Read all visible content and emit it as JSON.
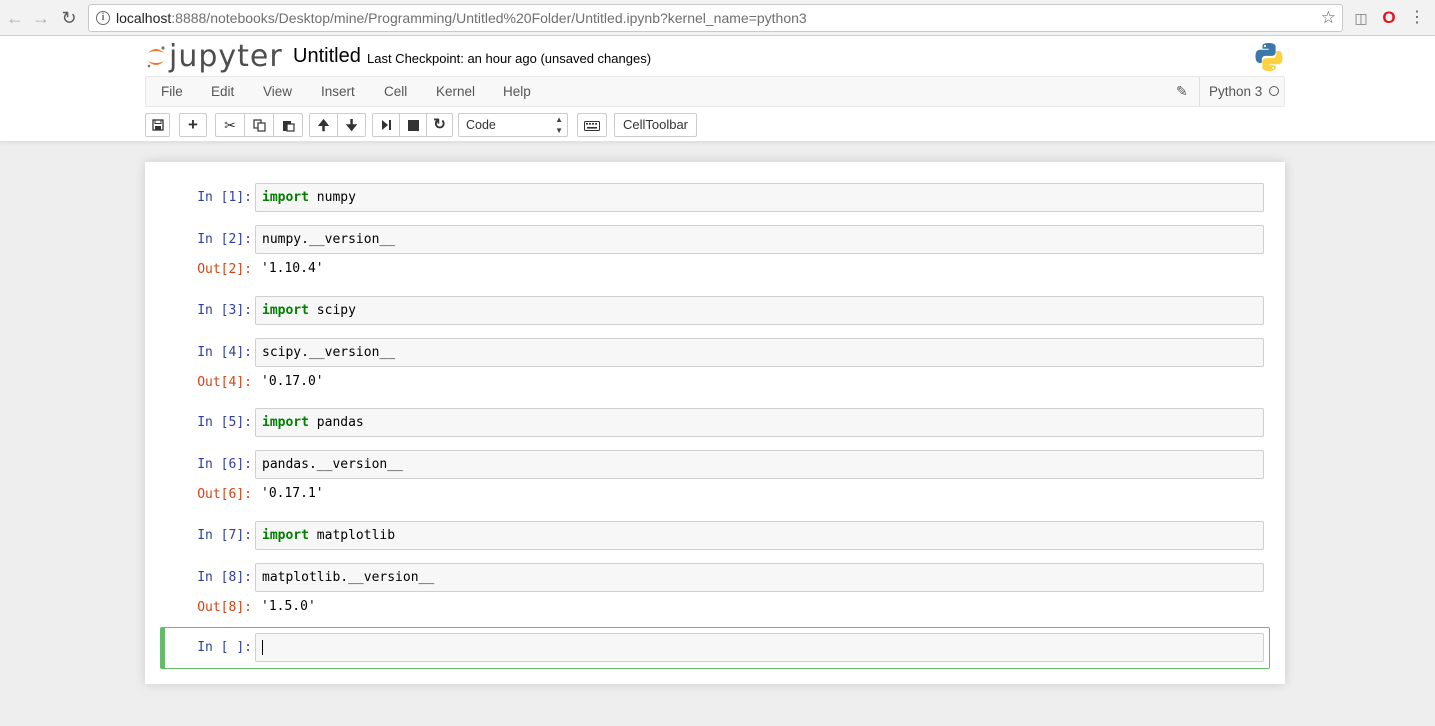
{
  "browser": {
    "url_host": "localhost",
    "url_rest": ":8888/notebooks/Desktop/mine/Programming/Untitled%20Folder/Untitled.ipynb?kernel_name=python3",
    "icons": [
      "back-arrow-icon",
      "forward-arrow-icon",
      "reload-icon",
      "info-icon",
      "star-icon",
      "extension-icon",
      "opera-icon",
      "menu-icon"
    ]
  },
  "header": {
    "logo_text": "jupyter",
    "notebook_title": "Untitled",
    "checkpoint": "Last Checkpoint: an hour ago (unsaved changes)",
    "accent_color": "#f37626"
  },
  "menu": {
    "items": [
      "File",
      "Edit",
      "View",
      "Insert",
      "Cell",
      "Kernel",
      "Help"
    ],
    "kernel_name": "Python 3"
  },
  "toolbar": {
    "cell_type": "Code",
    "celltoolbar_label": "CellToolbar",
    "icons": [
      "save-icon",
      "plus-icon",
      "cut-icon",
      "copy-icon",
      "paste-icon",
      "arrow-up-icon",
      "arrow-down-icon",
      "run-icon",
      "stop-icon",
      "restart-icon",
      "keyboard-icon"
    ]
  },
  "cells": [
    {
      "prompt": "In [1]:",
      "keyword": "import",
      "code": " numpy"
    },
    {
      "prompt": "In [2]:",
      "keyword": "",
      "code": "numpy.__version__",
      "out_prompt": "Out[2]:",
      "output": "'1.10.4'"
    },
    {
      "prompt": "In [3]:",
      "keyword": "import",
      "code": " scipy"
    },
    {
      "prompt": "In [4]:",
      "keyword": "",
      "code": "scipy.__version__",
      "out_prompt": "Out[4]:",
      "output": "'0.17.0'"
    },
    {
      "prompt": "In [5]:",
      "keyword": "import",
      "code": " pandas"
    },
    {
      "prompt": "In [6]:",
      "keyword": "",
      "code": "pandas.__version__",
      "out_prompt": "Out[6]:",
      "output": "'0.17.1'"
    },
    {
      "prompt": "In [7]:",
      "keyword": "import",
      "code": " matplotlib"
    },
    {
      "prompt": "In [8]:",
      "keyword": "",
      "code": "matplotlib.__version__",
      "out_prompt": "Out[8]:",
      "output": "'1.5.0'"
    },
    {
      "prompt": "In [ ]:",
      "keyword": "",
      "code": ""
    }
  ],
  "colors": {
    "in_prompt": "#303f9f",
    "out_prompt": "#d84315",
    "keyword": "#008000",
    "selected_border": "#66bb6a"
  }
}
